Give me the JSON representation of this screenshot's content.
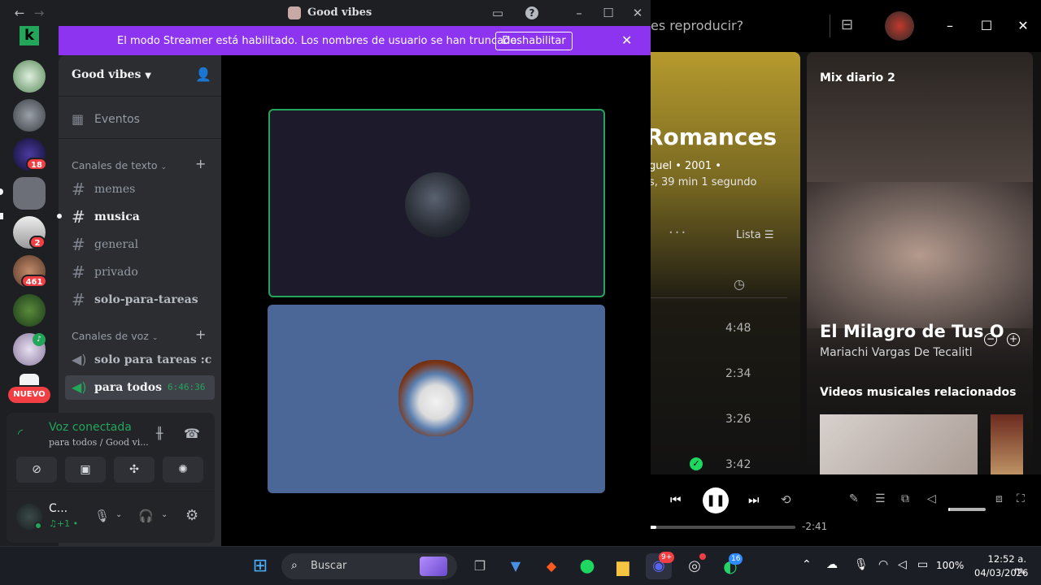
{
  "spotify": {
    "search_placeholder_partial": "es reproducir?",
    "album": {
      "title_partial": "Romances",
      "meta_line1": "guel • 2001 •",
      "meta_line2": "s, 39 min 1 segundo",
      "more_label": "···",
      "view_label": "Lista"
    },
    "track_times": [
      "4:48",
      "2:34",
      "3:26",
      "3:42"
    ],
    "now_playing_panel": {
      "playlist": "Mix diario 2",
      "song_title": "El Milagro de Tus O",
      "artist": "Mariachi Vargas De Tecalitl",
      "related_heading": "Videos musicales relacionados"
    },
    "player": {
      "remaining_time": "-2:41",
      "progress_fraction": 0.05,
      "volume_fraction": 0.05
    }
  },
  "discord": {
    "window_title": "Good vibes",
    "streamer_banner": {
      "text": "El modo Streamer está habilitado. Los nombres de usuario se han truncado.",
      "button_label": "Deshabilitar"
    },
    "servers": {
      "badges": [
        "18",
        "2",
        "461"
      ],
      "new_label": "NUEVO"
    },
    "guild": {
      "name": "Good vibes",
      "events_label": "Eventos",
      "text_category": "Canales de texto",
      "text_channels": [
        "memes",
        "musica",
        "general",
        "privado",
        "solo-para-tareas"
      ],
      "voice_category": "Canales de voz",
      "voice_channels": [
        "solo para tareas :c",
        "para todos"
      ],
      "voice_duration": "6:46:36"
    },
    "voice_panel": {
      "status": "Voz conectada",
      "location": "para todos / Good vi..."
    },
    "user": {
      "name": "C...",
      "status": "♫+1 •"
    }
  },
  "taskbar": {
    "search_label": "Buscar",
    "battery": "100%",
    "time": "12:52 a. m.",
    "date": "04/03/2026",
    "discord_badge": "9+",
    "whatsapp_badge": "16"
  }
}
